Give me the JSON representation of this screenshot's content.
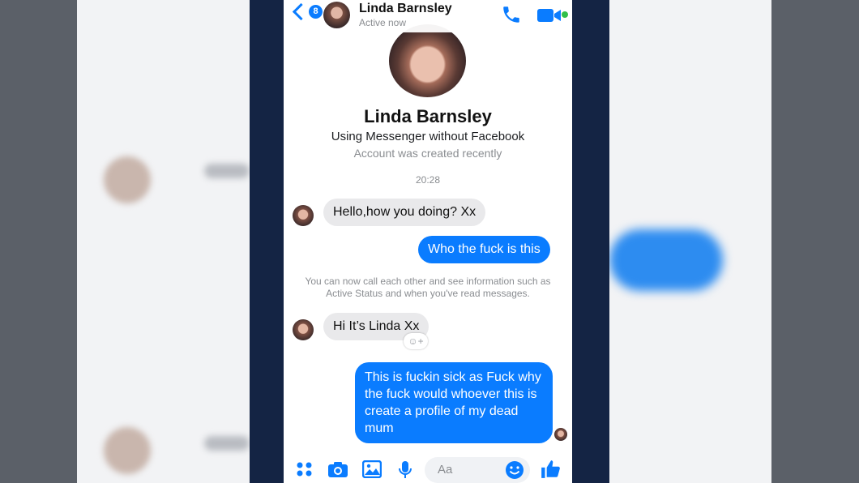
{
  "header": {
    "unread_count": "8",
    "contact_name": "Linda Barnsley",
    "status": "Active now"
  },
  "profile": {
    "name": "Linda Barnsley",
    "subtitle": "Using Messenger without Facebook",
    "note": "Account was created recently"
  },
  "conversation": {
    "timestamp": "20:28",
    "messages": [
      {
        "from": "them",
        "text": "Hello,how you doing? Xx"
      },
      {
        "from": "me",
        "text": "Who the fuck is this"
      },
      {
        "from": "them",
        "text": "Hi It’s Linda Xx"
      },
      {
        "from": "me",
        "text": "This is fuckin sick as Fuck why the fuck would whoever this is create a profile of my dead mum"
      }
    ],
    "system_note": "You can now call each other and see information such as Active Status and when you've read messages."
  },
  "composer": {
    "placeholder": "Aa",
    "icons": [
      "apps-icon",
      "camera-icon",
      "gallery-icon",
      "microphone-icon",
      "emoji-icon",
      "thumbs-up-icon"
    ]
  },
  "colors": {
    "accent": "#0a7cff",
    "incoming_bubble": "#e9e9eb",
    "frame": "#142444",
    "online": "#31c04a"
  }
}
